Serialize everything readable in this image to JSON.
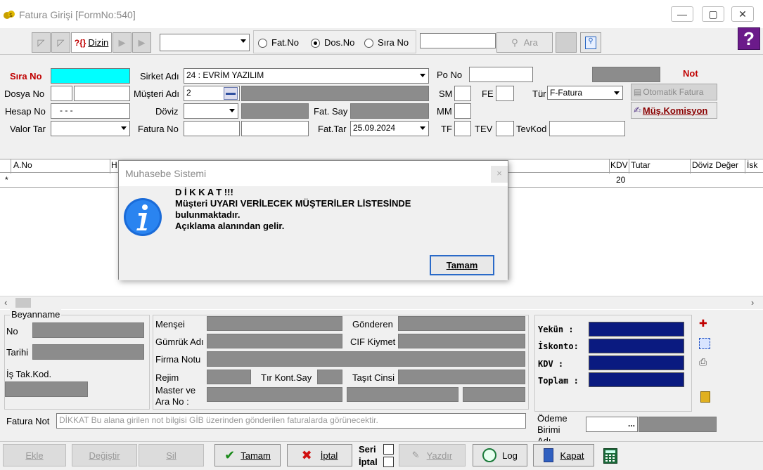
{
  "window": {
    "title": "Fatura Girişi [FormNo:540]",
    "minimize": "—",
    "maximize": "▢",
    "close": "✕"
  },
  "toolbar": {
    "dizin": "Dizin",
    "radio_fatno": "Fat.No",
    "radio_dosno": "Dos.No",
    "radio_sirano": "Sıra No",
    "selected_radio": "Dos.No",
    "search_button": "Ara",
    "combo_value": "",
    "search_value": ""
  },
  "header": {
    "sira_no_label": "Sıra No",
    "dosya_no_label": "Dosya No",
    "hesap_no_label": "Hesap No",
    "hesap_no_value": "- - -",
    "valor_tar_label": "Valor Tar",
    "sirket_adi_label": "Sirket Adı",
    "sirket_adi_value": "24 : EVRİM YAZILIM",
    "musteri_adi_label": "Müşteri Adı",
    "musteri_adi_value": "2",
    "doviz_label": "Döviz",
    "fatura_no_label": "Fatura No",
    "fat_say_label": "Fat. Say",
    "fat_tar_label": "Fat.Tar",
    "fat_tar_value": "25.09.2024",
    "po_no_label": "Po No",
    "sm_label": "SM",
    "fe_label": "FE",
    "mm_label": "MM",
    "tf_label": "TF",
    "tev_label": "TEV",
    "tevkod_label": "TevKod",
    "tur_label": "Tür",
    "tur_value": "F-Fatura",
    "not_label": "Not",
    "otomatik_fatura": "Otomatik Fatura",
    "mus_komisyon": "Müş.Komisyon"
  },
  "grid": {
    "columns": [
      "A.No",
      "H",
      "KDV",
      "Tutar",
      "Döviz Değer",
      "İsk"
    ],
    "row_marker": "*",
    "kdv_value": "20"
  },
  "dialog": {
    "title": "Muhasebe Sistemi",
    "close": "×",
    "line1": "D İ K K A T !!!",
    "line2": "Müşteri UYARI VERİLECEK MÜŞTERİLER LİSTESİNDE",
    "line3": "bulunmaktadır.",
    "line4": "Açıklama alanından gelir.",
    "ok_button": "Tamam"
  },
  "beyanname": {
    "group_title": "Beyanname",
    "no_label": "No",
    "tarihi_label": "Tarihi",
    "is_tak_kod_label": "İş Tak.Kod."
  },
  "details": {
    "mensei_label": "Menşei",
    "gonderen_label": "Gönderen",
    "gumruk_adi_label": "Gümrük Adı",
    "cif_kiymet_label": "CIF Kiymet",
    "firma_notu_label": "Firma Notu",
    "rejim_label": "Rejim",
    "tir_kont_say_label": "Tır Kont.Say",
    "tasit_cinsi_label": "Taşıt Cinsi",
    "master_label_1": "Master ve",
    "master_label_2": "Ara No :"
  },
  "totals": {
    "yekun_label": "Yekün  :",
    "iskonto_label": "İskonto:",
    "kdv_label": "KDV    :",
    "toplam_label": "Toplam :"
  },
  "fatura_not": {
    "label": "Fatura Not",
    "placeholder": "DİKKAT Bu alana girilen not bilgisi GİB üzerinden gönderilen faturalarda görünecektir."
  },
  "odeme": {
    "label_1": "Ödeme",
    "label_2": "Birimi",
    "label_3": "Adı",
    "ellipsis": "..."
  },
  "buttons": {
    "ekle": "Ekle",
    "degistir": "Değiştir",
    "sil": "Sil",
    "tamam": "Tamam",
    "iptal": "İptal",
    "seri": "Seri",
    "iptal_check": "İptal",
    "yazdir": "Yazdır",
    "log": "Log",
    "kapat": "Kapat"
  },
  "colors": {
    "cyan_field": "#00ffff",
    "navy_total": "#0a1a80",
    "label_red": "#c00000"
  }
}
